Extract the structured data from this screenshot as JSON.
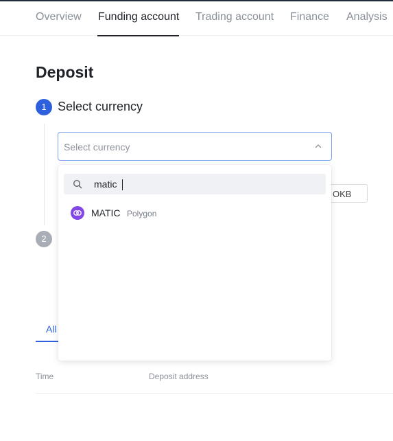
{
  "nav": {
    "tabs": [
      {
        "label": "Overview"
      },
      {
        "label": "Funding account"
      },
      {
        "label": "Trading account"
      },
      {
        "label": "Finance"
      },
      {
        "label": "Analysis"
      }
    ],
    "active_tab": "Funding account"
  },
  "page": {
    "title": "Deposit"
  },
  "steps": [
    {
      "number": "1",
      "label": "Select currency"
    },
    {
      "number": "2",
      "label": ""
    }
  ],
  "currency_select": {
    "placeholder": "Select currency",
    "expanded": true,
    "chevron_icon": "chevron-up-icon"
  },
  "background_chip": {
    "label": "OKB"
  },
  "dropdown": {
    "search_icon": "search-icon",
    "search_value": "matic",
    "options": [
      {
        "symbol": "MATIC",
        "name": "Polygon",
        "icon": "polygon-coin-icon",
        "icon_color": "#8247e5"
      }
    ]
  },
  "history": {
    "tab_label": "All",
    "columns": [
      "Time",
      "Deposit address"
    ]
  },
  "colors": {
    "accent": "#2e5fdc",
    "step_inactive": "#a9adb5",
    "select_border": "#7aa0ee"
  }
}
